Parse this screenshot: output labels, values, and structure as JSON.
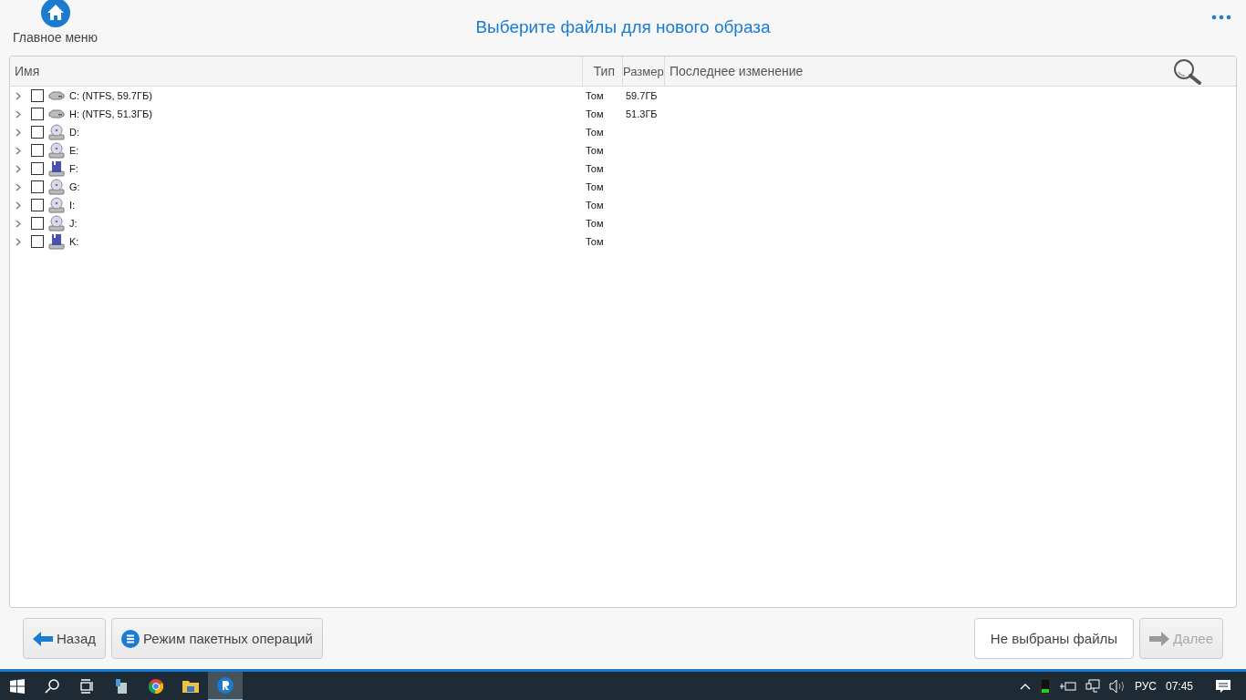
{
  "header": {
    "home_label": "Главное меню",
    "title": "Выберите файлы для нового образа"
  },
  "table": {
    "columns": [
      "Имя",
      "Тип",
      "Размер",
      "Последнее изменение"
    ],
    "rows": [
      {
        "name": "C: (NTFS, 59.7ГБ)",
        "type": "Том",
        "size": "59.7ГБ",
        "kind": "hdd",
        "checked": false
      },
      {
        "name": "H: (NTFS, 51.3ГБ)",
        "type": "Том",
        "size": "51.3ГБ",
        "kind": "hdd",
        "checked": false
      },
      {
        "name": "D:",
        "type": "Том",
        "kind": "cd",
        "checked": false
      },
      {
        "name": "E:",
        "type": "Том",
        "kind": "cd",
        "checked": false
      },
      {
        "name": "F:",
        "type": "Том",
        "kind": "floppy",
        "checked": false
      },
      {
        "name": "G:",
        "type": "Том",
        "kind": "cd",
        "checked": false
      },
      {
        "name": "I:",
        "type": "Том",
        "kind": "cd",
        "checked": false
      },
      {
        "name": "J:",
        "type": "Том",
        "kind": "cd",
        "checked": false
      },
      {
        "name": "K:",
        "type": "Том",
        "kind": "floppy",
        "checked": false
      }
    ]
  },
  "footer": {
    "back": "Назад",
    "batch": "Режим пакетных операций",
    "status": "Не выбраны файлы",
    "next": {
      "label": "Далее",
      "disabled": true
    }
  },
  "taskbar": {
    "language": "РУС",
    "time": "07:45"
  }
}
